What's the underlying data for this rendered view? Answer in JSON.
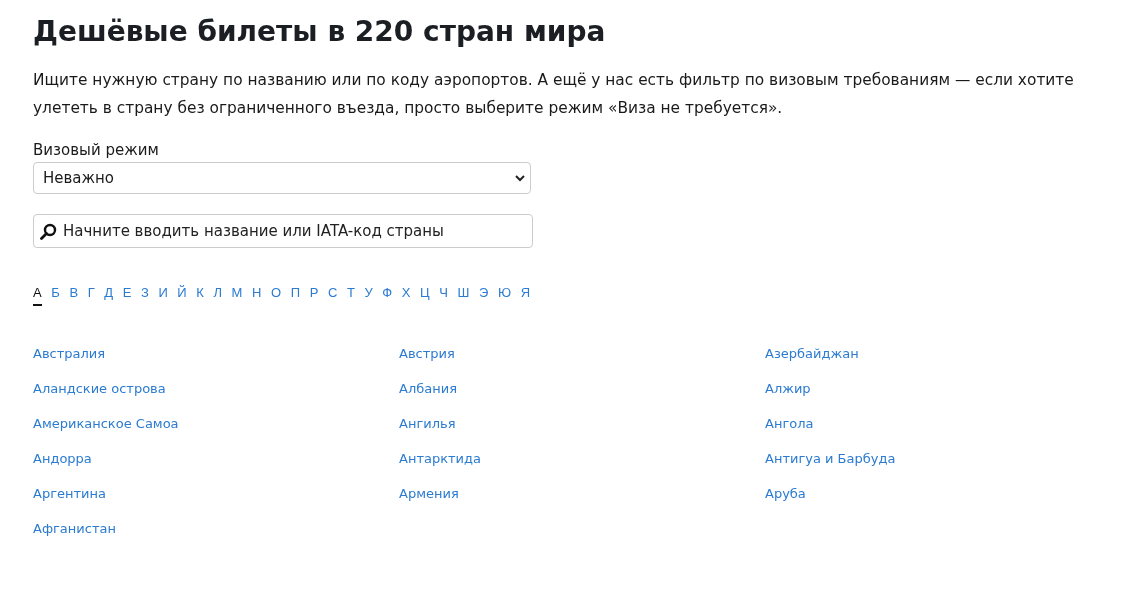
{
  "title": "Дешёвые билеты в 220 стран мира",
  "intro": "Ищите нужную страну по названию или по коду аэропортов. А ещё у нас есть фильтр по визовым требованиям — если хотите улететь в страну без ограниченного въезда, просто выберите режим «Виза не требуется».",
  "visa_filter": {
    "label": "Визовый режим",
    "value": "Неважно"
  },
  "search": {
    "placeholder": "Начните вводить название или IATA-код страны"
  },
  "letters": [
    {
      "label": "А",
      "selected": true
    },
    {
      "label": "Б",
      "selected": false
    },
    {
      "label": "В",
      "selected": false
    },
    {
      "label": "Г",
      "selected": false
    },
    {
      "label": "Д",
      "selected": false
    },
    {
      "label": "Е",
      "selected": false
    },
    {
      "label": "З",
      "selected": false
    },
    {
      "label": "И",
      "selected": false
    },
    {
      "label": "Й",
      "selected": false
    },
    {
      "label": "К",
      "selected": false
    },
    {
      "label": "Л",
      "selected": false
    },
    {
      "label": "М",
      "selected": false
    },
    {
      "label": "Н",
      "selected": false
    },
    {
      "label": "О",
      "selected": false
    },
    {
      "label": "П",
      "selected": false
    },
    {
      "label": "Р",
      "selected": false
    },
    {
      "label": "С",
      "selected": false
    },
    {
      "label": "Т",
      "selected": false
    },
    {
      "label": "У",
      "selected": false
    },
    {
      "label": "Ф",
      "selected": false
    },
    {
      "label": "Х",
      "selected": false
    },
    {
      "label": "Ц",
      "selected": false
    },
    {
      "label": "Ч",
      "selected": false
    },
    {
      "label": "Ш",
      "selected": false
    },
    {
      "label": "Э",
      "selected": false
    },
    {
      "label": "Ю",
      "selected": false
    },
    {
      "label": "Я",
      "selected": false
    }
  ],
  "countries": [
    "Австралия",
    "Австрия",
    "Азербайджан",
    "Аландские острова",
    "Албания",
    "Алжир",
    "Американское Самоа",
    "Ангилья",
    "Ангола",
    "Андорра",
    "Антарктида",
    "Антигуа и Барбуда",
    "Аргентина",
    "Армения",
    "Аруба",
    "Афганистан"
  ]
}
